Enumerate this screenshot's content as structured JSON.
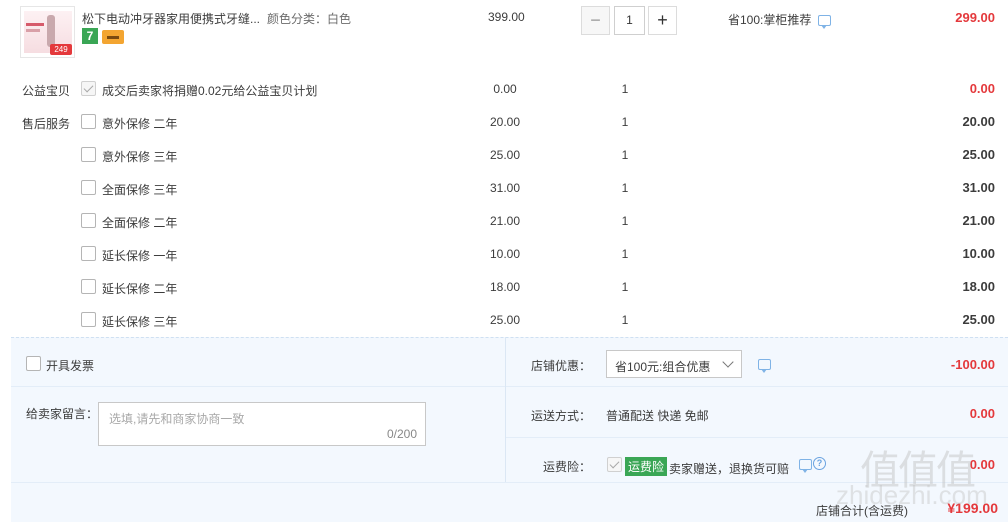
{
  "product": {
    "title": "松下电动冲牙器家用便携式牙缝...",
    "sku": "颜色分类：白色",
    "badge_number": "7",
    "unit_price": "399.00",
    "quantity": "1",
    "promo": "省100:掌柜推荐",
    "total": "299.00",
    "thumb_price": "249"
  },
  "charity": {
    "label": "公益宝贝",
    "text": "成交后卖家将捐赠0.02元给公益宝贝计划",
    "price": "0.00",
    "qty": "1",
    "total": "0.00"
  },
  "after_sales": {
    "label": "售后服务",
    "items": [
      {
        "name": "意外保修 二年",
        "price": "20.00",
        "qty": "1",
        "total": "20.00"
      },
      {
        "name": "意外保修 三年",
        "price": "25.00",
        "qty": "1",
        "total": "25.00"
      },
      {
        "name": "全面保修 三年",
        "price": "31.00",
        "qty": "1",
        "total": "31.00"
      },
      {
        "name": "全面保修 二年",
        "price": "21.00",
        "qty": "1",
        "total": "21.00"
      },
      {
        "name": "延长保修 一年",
        "price": "10.00",
        "qty": "1",
        "total": "10.00"
      },
      {
        "name": "延长保修 二年",
        "price": "18.00",
        "qty": "1",
        "total": "18.00"
      },
      {
        "name": "延长保修 三年",
        "price": "25.00",
        "qty": "1",
        "total": "25.00"
      }
    ]
  },
  "invoice": {
    "label": "开具发票"
  },
  "memo": {
    "label": "给卖家留言：",
    "placeholder": "选填,请先和商家协商一致",
    "counter": "0/200"
  },
  "shop_discount": {
    "label": "店铺优惠：",
    "selected": "省100元:组合优惠",
    "value": "-100.00"
  },
  "shipping": {
    "label": "运送方式：",
    "value": "普通配送 快递 免邮",
    "price": "0.00"
  },
  "insurance": {
    "label": "运费险：",
    "tag": "运费险",
    "text": "卖家赠送，退换货可赔",
    "price": "0.00"
  },
  "summary": {
    "label": "店铺合计(含运费)",
    "value": "¥199.00"
  },
  "watermark": {
    "text": "值值值",
    "sub": "zhidezhi.com"
  },
  "colors": {
    "accent_red": "#e4393c",
    "panel_bg": "#f3f8fe",
    "green": "#3aa655"
  }
}
